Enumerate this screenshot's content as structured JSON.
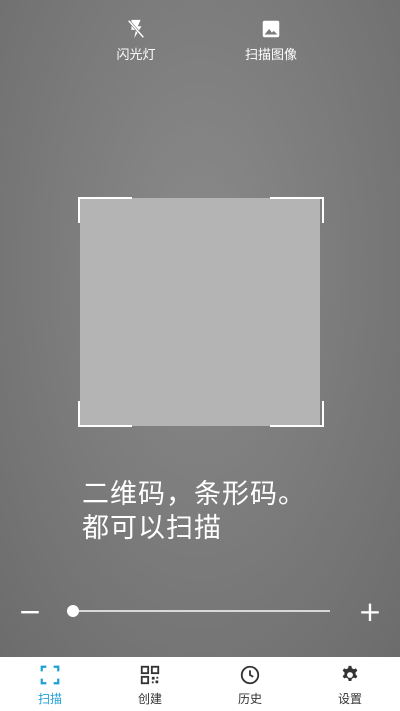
{
  "top_actions": {
    "flash_label": "闪光灯",
    "scan_image_label": "扫描图像"
  },
  "hint": {
    "line1": "二维码，条形码。",
    "line2": "都可以扫描"
  },
  "zoom": {
    "minus_label": "−",
    "plus_label": "+",
    "level": 0.02
  },
  "tabs": [
    {
      "label": "扫描",
      "icon": "scan-icon",
      "active": true
    },
    {
      "label": "创建",
      "icon": "qr-code-icon",
      "active": false
    },
    {
      "label": "历史",
      "icon": "clock-icon",
      "active": false
    },
    {
      "label": "设置",
      "icon": "gear-icon",
      "active": false
    }
  ],
  "colors": {
    "accent": "#1e9fd8",
    "tab_text": "#333333",
    "overlay_text": "#ffffff"
  }
}
